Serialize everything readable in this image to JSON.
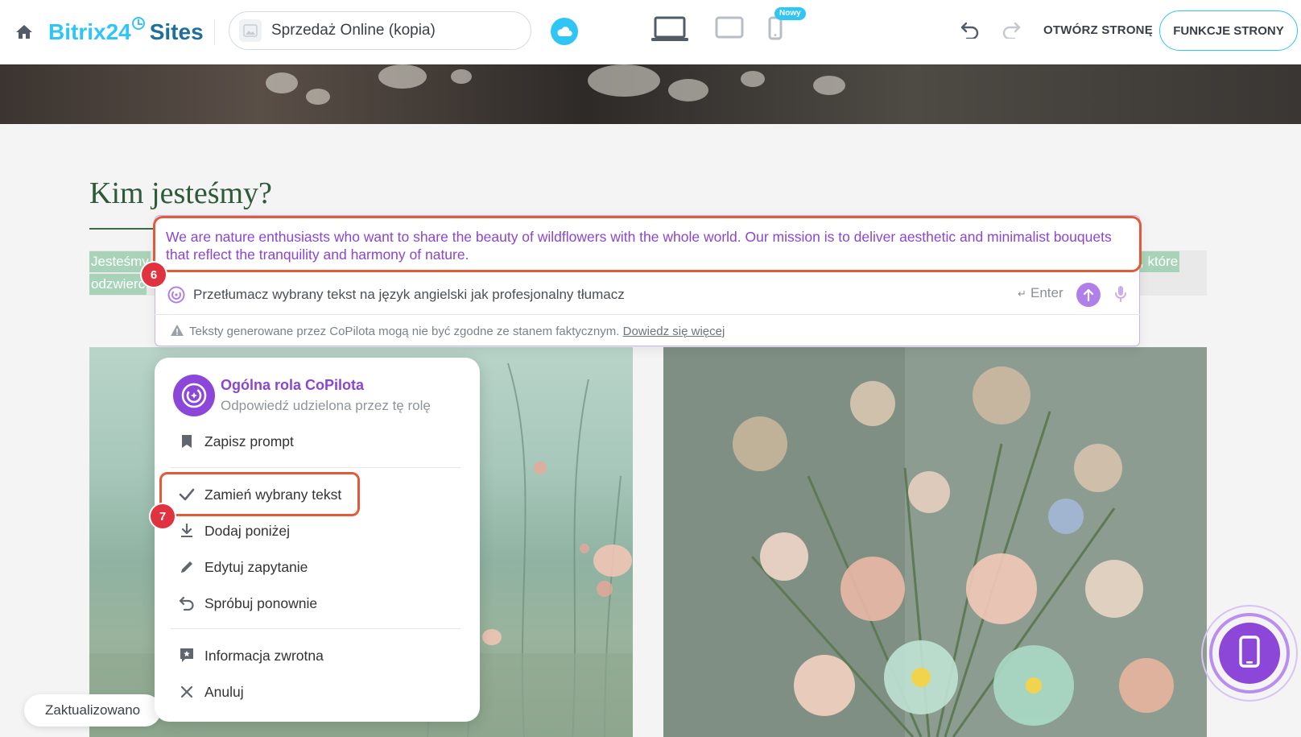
{
  "header": {
    "logo_brand": "Bitrix24",
    "logo_product": "Sites",
    "site_name": "Sprzedaż Online (kopia)",
    "new_badge": "Nowy",
    "open_page_label": "OTWÓRZ STRONĘ",
    "page_functions_label": "FUNKCJE STRONY"
  },
  "section": {
    "title": "Kim jesteśmy?",
    "highlight_line1": "Jesteśmy",
    "highlight_line2": "odzwierc",
    "highlight_right": ", które"
  },
  "copilot": {
    "result_text": "We are nature enthusiasts who want to share the beauty of wildflowers with the whole world. Our mission is to deliver aesthetic and minimalist bouquets that reflect the tranquility and harmony of nature.",
    "prompt_value": "Przetłumacz wybrany tekst na język angielski jak profesjonalny tłumacz",
    "enter_hint": "Enter",
    "disclaimer": "Teksty generowane przez CoPilota mogą nie być zgodne ze stanem faktycznym.",
    "learn_more": "Dowiedz się więcej"
  },
  "steps": {
    "step6": "6",
    "step7": "7"
  },
  "menu": {
    "role_name": "Ogólna rola CoPilota",
    "role_subtitle": "Odpowiedź udzielona przez tę rolę",
    "items": [
      {
        "label": "Zapisz prompt",
        "icon": "bookmark-icon"
      },
      {
        "label": "Zamień wybrany tekst",
        "icon": "check-icon"
      },
      {
        "label": "Dodaj poniżej",
        "icon": "download-icon"
      },
      {
        "label": "Edytuj zapytanie",
        "icon": "pencil-icon"
      },
      {
        "label": "Spróbuj ponownie",
        "icon": "undo-icon"
      },
      {
        "label": "Informacja zwrotna",
        "icon": "feedback-icon"
      },
      {
        "label": "Anuluj",
        "icon": "close-icon"
      }
    ]
  },
  "status": {
    "updated_label": "Zaktualizowano"
  },
  "colors": {
    "accent": "#2fc6f6",
    "copilot_purple": "#8a46d1",
    "annotation_red": "#e35a3a"
  }
}
